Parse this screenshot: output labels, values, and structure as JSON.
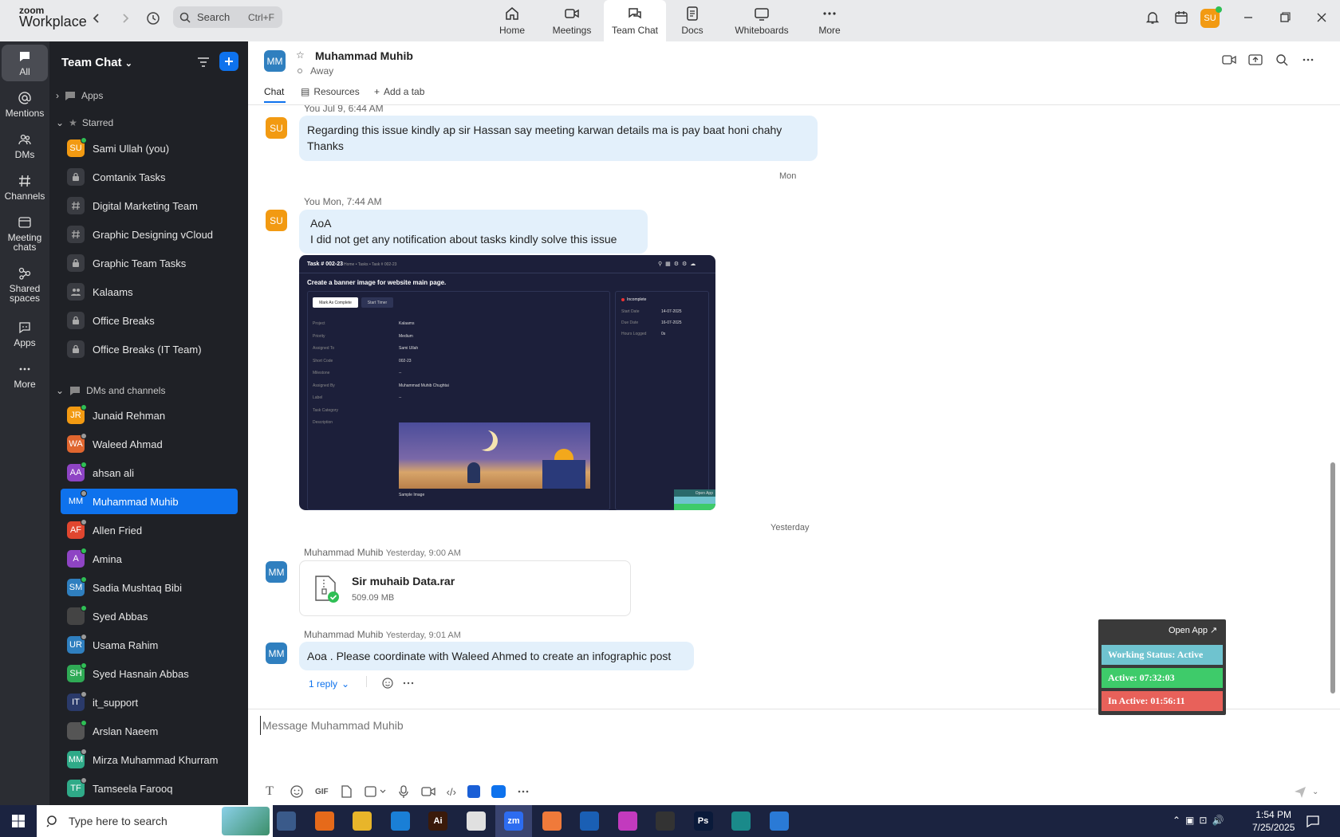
{
  "app": {
    "brand_small": "zoom",
    "brand": "Workplace"
  },
  "search": {
    "label": "Search",
    "shortcut": "Ctrl+F"
  },
  "top_tabs": [
    {
      "label": "Home",
      "icon": "home-icon"
    },
    {
      "label": "Meetings",
      "icon": "video-icon"
    },
    {
      "label": "Team Chat",
      "icon": "chat-icon"
    },
    {
      "label": "Docs",
      "icon": "doc-icon"
    },
    {
      "label": "Whiteboards",
      "icon": "whiteboard-icon"
    },
    {
      "label": "More",
      "icon": "more-icon"
    }
  ],
  "user_avatar": "SU",
  "rail": [
    {
      "label": "All"
    },
    {
      "label": "Mentions"
    },
    {
      "label": "DMs"
    },
    {
      "label": "Channels"
    },
    {
      "label": "Meeting chats"
    },
    {
      "label": "Shared spaces"
    },
    {
      "label": "Apps"
    },
    {
      "label": "More"
    }
  ],
  "sidebar": {
    "title": "Team Chat",
    "apps_label": "Apps",
    "starred_label": "Starred",
    "starred": [
      {
        "label": "Sami Ullah (you)",
        "avatar": "SU",
        "color": "#f29a12",
        "status": "#2fbf55"
      },
      {
        "label": "Comtanix Tasks",
        "icon": "lock-icon"
      },
      {
        "label": "Digital Marketing Team",
        "icon": "hash-icon"
      },
      {
        "label": "Graphic Designing vCloud",
        "icon": "hash-icon"
      },
      {
        "label": "Graphic Team Tasks",
        "icon": "lock-icon"
      },
      {
        "label": "Kalaams",
        "icon": "group-icon"
      },
      {
        "label": "Office Breaks",
        "icon": "lock-icon"
      },
      {
        "label": "Office Breaks (IT Team)",
        "icon": "lock-icon"
      }
    ],
    "dms_label": "DMs and channels",
    "dms": [
      {
        "label": "Junaid Rehman",
        "avatar": "JR",
        "color": "#f29a12",
        "status": "#2fbf55"
      },
      {
        "label": "Waleed Ahmad",
        "avatar": "WA",
        "color": "#e0662f",
        "status": "#9a9a9a"
      },
      {
        "label": "ahsan ali",
        "avatar": "AA",
        "color": "#8e44c4",
        "status": "#2fbf55"
      },
      {
        "label": "Muhammad Muhib",
        "avatar": "MM",
        "color": "#0e72ed",
        "status": "#9a9a9a"
      },
      {
        "label": "Allen Fried",
        "avatar": "AF",
        "color": "#e0462f",
        "status": "#9a9a9a"
      },
      {
        "label": "Amina",
        "avatar": "A",
        "color": "#8e44c4",
        "status": "#2fbf55"
      },
      {
        "label": "Sadia Mushtaq Bibi",
        "avatar": "SM",
        "color": "#2f7fbf",
        "status": "#2fbf55"
      },
      {
        "label": "Syed Abbas",
        "avatar": "",
        "color": "#444",
        "status": "#2fbf55"
      },
      {
        "label": "Usama Rahim",
        "avatar": "UR",
        "color": "#2f7fbf",
        "status": "#9a9a9a"
      },
      {
        "label": "Syed Hasnain Abbas",
        "avatar": "SH",
        "color": "#2faa55",
        "status": "#2fbf55"
      },
      {
        "label": "it_support",
        "avatar": "IT",
        "color": "#2a3a6a",
        "status": "#9a9a9a"
      },
      {
        "label": "Arslan Naeem",
        "avatar": "",
        "color": "#555",
        "status": "#2fbf55"
      },
      {
        "label": "Mirza Muhammad Khurram",
        "avatar": "MM",
        "color": "#2faa88",
        "status": "#9a9a9a"
      },
      {
        "label": "Tamseela Farooq",
        "avatar": "TF",
        "color": "#2faa88",
        "status": "#9a9a9a"
      }
    ]
  },
  "chat": {
    "contact_avatar": "MM",
    "contact_name": "Muhammad Muhib",
    "presence": "Away",
    "tabs": {
      "chat": "Chat",
      "resources": "Resources",
      "add": "Add a tab"
    },
    "messages": [
      {
        "avatar": "SU",
        "sender": "You",
        "time": "Jul 9, 6:44 AM",
        "lines": [
          "Regarding this issue kindly ap sir Hassan say meeting karwan details ma is pay baat honi chahy",
          "Thanks"
        ]
      },
      {
        "day": "Mon"
      },
      {
        "avatar": "SU",
        "sender": "You",
        "time": "Mon, 7:44 AM",
        "lines": [
          "AoA",
          "I did not get any notification about tasks kindly solve this issue"
        ]
      },
      {
        "day": "Yesterday"
      },
      {
        "avatar": "MM",
        "sender": "Muhammad Muhib",
        "time": "Yesterday, 9:00 AM",
        "file_name": "Sir muhaib Data.rar",
        "file_size": "509.09 MB"
      },
      {
        "avatar": "MM",
        "sender": "Muhammad Muhib",
        "time": "Yesterday, 9:01 AM",
        "lines": [
          "Aoa . Please coordinate with Waleed Ahmed to create an infographic post"
        ],
        "reply": "1 reply"
      }
    ],
    "screenshot": {
      "task_id": "Task # 002-23",
      "breadcrumb": "Home • Tasks • Task # 002-23",
      "heading": "Create a banner image for website main page.",
      "btn_complete": "Mark As Complete",
      "btn_timer": "Start Timer",
      "fields": [
        [
          "Project",
          "Kalaams"
        ],
        [
          "Priority",
          "Medium"
        ],
        [
          "Assigned To",
          "Sami Ullah"
        ],
        [
          "Short Code",
          "002-23"
        ],
        [
          "Milestone",
          "--"
        ],
        [
          "Assigned By",
          "Muhammad Muhib Chughtai"
        ],
        [
          "Label",
          "--"
        ],
        [
          "Task Category",
          ""
        ],
        [
          "Description",
          ""
        ]
      ],
      "status": "Incomplete",
      "side": [
        [
          "Start Date",
          "14-07-2025"
        ],
        [
          "Due Date",
          "16-07-2025"
        ],
        [
          "Hours Logged",
          "0s"
        ]
      ],
      "caption": "Sample Image",
      "open_app": "Open App"
    },
    "composer_placeholder": "Message Muhammad Muhib"
  },
  "widget": {
    "open_app": "Open App ↗",
    "working": "Working Status: Active",
    "active": "Active: 07:32:03",
    "inactive": "In Active: 01:56:11",
    "colors": {
      "working": "#6fc3cf",
      "active": "#3ecb6a",
      "inactive": "#e8615a"
    }
  },
  "taskbar": {
    "search": "Type here to search",
    "time": "1:54 PM",
    "date": "7/25/2025",
    "apps": [
      {
        "label": "",
        "color": "#3a5a8a"
      },
      {
        "label": "",
        "color": "#e66a1a"
      },
      {
        "label": "",
        "color": "#e8b52a"
      },
      {
        "label": "",
        "color": "#1a7fd6"
      },
      {
        "label": "Ai",
        "color": "#3a1a0a"
      },
      {
        "label": "",
        "color": "#e0e0e0"
      },
      {
        "label": "zm",
        "color": "#2d6cf0"
      },
      {
        "label": "",
        "color": "#f07a3a"
      },
      {
        "label": "",
        "color": "#1a5fb4"
      },
      {
        "label": "",
        "color": "#c23abe"
      },
      {
        "label": "",
        "color": "#333"
      },
      {
        "label": "Ps",
        "color": "#0a1a3a"
      },
      {
        "label": "",
        "color": "#1a8a8a"
      },
      {
        "label": "",
        "color": "#2a7ad6"
      }
    ]
  }
}
